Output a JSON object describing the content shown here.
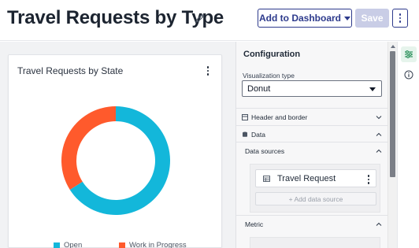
{
  "header": {
    "title": "Travel Requests by Type",
    "add_to_dashboard_label": "Add to Dashboard",
    "save_label": "Save"
  },
  "widget": {
    "title": "Travel Requests by State",
    "chart_data": {
      "type": "pie",
      "variant": "donut",
      "categories": [
        "Open",
        "Work in Progress"
      ],
      "values": [
        66,
        34
      ],
      "colors": [
        "#13b7da",
        "#ff5a2c"
      ],
      "legend": "bottom"
    }
  },
  "config": {
    "title": "Configuration",
    "viz_type_label": "Visualization type",
    "viz_type_value": "Donut",
    "sections": {
      "header_border": "Header and border",
      "data": "Data",
      "data_sources": "Data sources",
      "metric": "Metric"
    },
    "data_source_item": "Travel Request",
    "add_data_source": "+ Add data source"
  },
  "rail": {
    "icons": [
      "settings-sliders-icon",
      "info-icon"
    ]
  },
  "colors": {
    "accent": "#2d3a8c",
    "open": "#13b7da",
    "wip": "#ff5a2c"
  }
}
